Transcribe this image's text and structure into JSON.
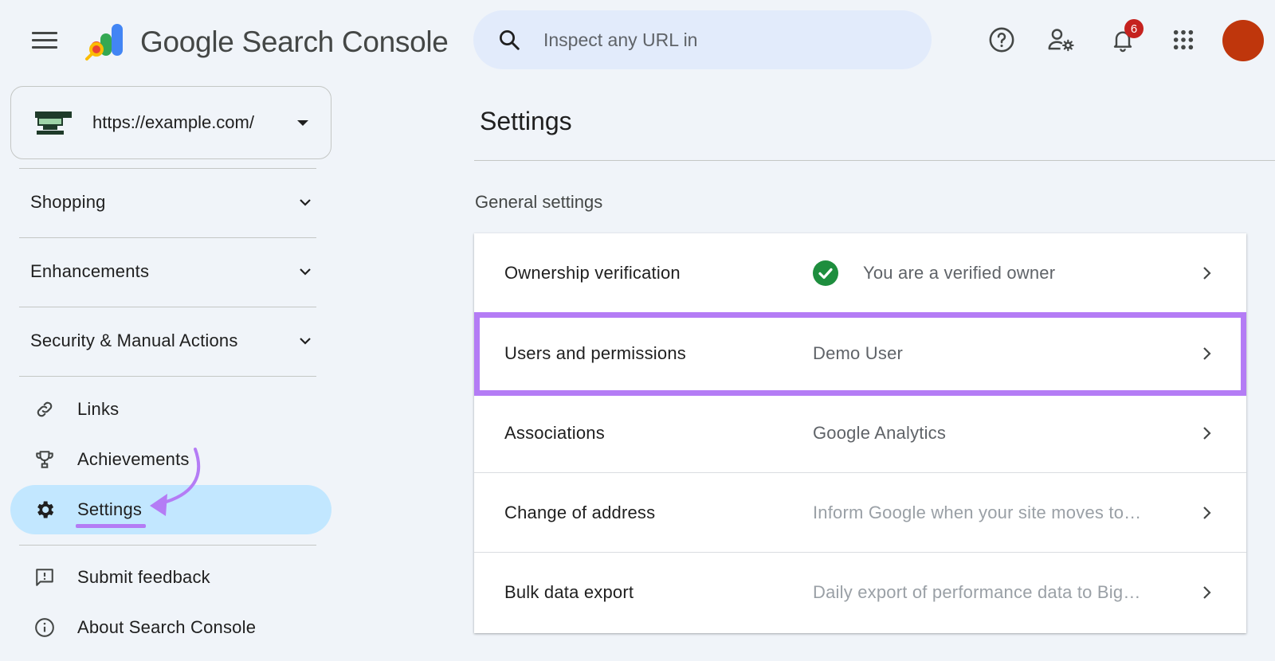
{
  "header": {
    "brand_word": "Google",
    "brand_rest": " Search Console",
    "search_placeholder": "Inspect any URL in",
    "notification_count": "6",
    "icons": [
      "menu-icon",
      "search-icon",
      "help-icon",
      "manage-users-icon",
      "notifications-icon",
      "apps-icon",
      "avatar"
    ]
  },
  "sidebar": {
    "property_url": "https://example.com/",
    "sections": [
      {
        "label": "Shopping"
      },
      {
        "label": "Enhancements"
      },
      {
        "label": "Security & Manual Actions"
      }
    ],
    "items": [
      {
        "label": "Links",
        "icon": "link-icon"
      },
      {
        "label": "Achievements",
        "icon": "trophy-icon"
      },
      {
        "label": "Settings",
        "icon": "gear-icon",
        "active": true
      },
      {
        "label": "Submit feedback",
        "icon": "feedback-icon"
      },
      {
        "label": "About Search Console",
        "icon": "info-icon"
      }
    ]
  },
  "main": {
    "title": "Settings",
    "subtitle": "General settings",
    "rows": [
      {
        "label": "Ownership verification",
        "value": "You are a verified owner"
      },
      {
        "label": "Users and permissions",
        "value": "Demo User"
      },
      {
        "label": "Associations",
        "value": "Google Analytics"
      },
      {
        "label": "Change of address",
        "value": "Inform Google when your site moves to…"
      },
      {
        "label": "Bulk data export",
        "value": "Daily export of performance data to Big…"
      }
    ]
  },
  "colors": {
    "accent_highlight": "#b47cf5",
    "active_nav": "#c2e7ff",
    "background": "#f0f4f9",
    "verified_green": "#1e8e3e",
    "avatar": "#bf360c"
  }
}
